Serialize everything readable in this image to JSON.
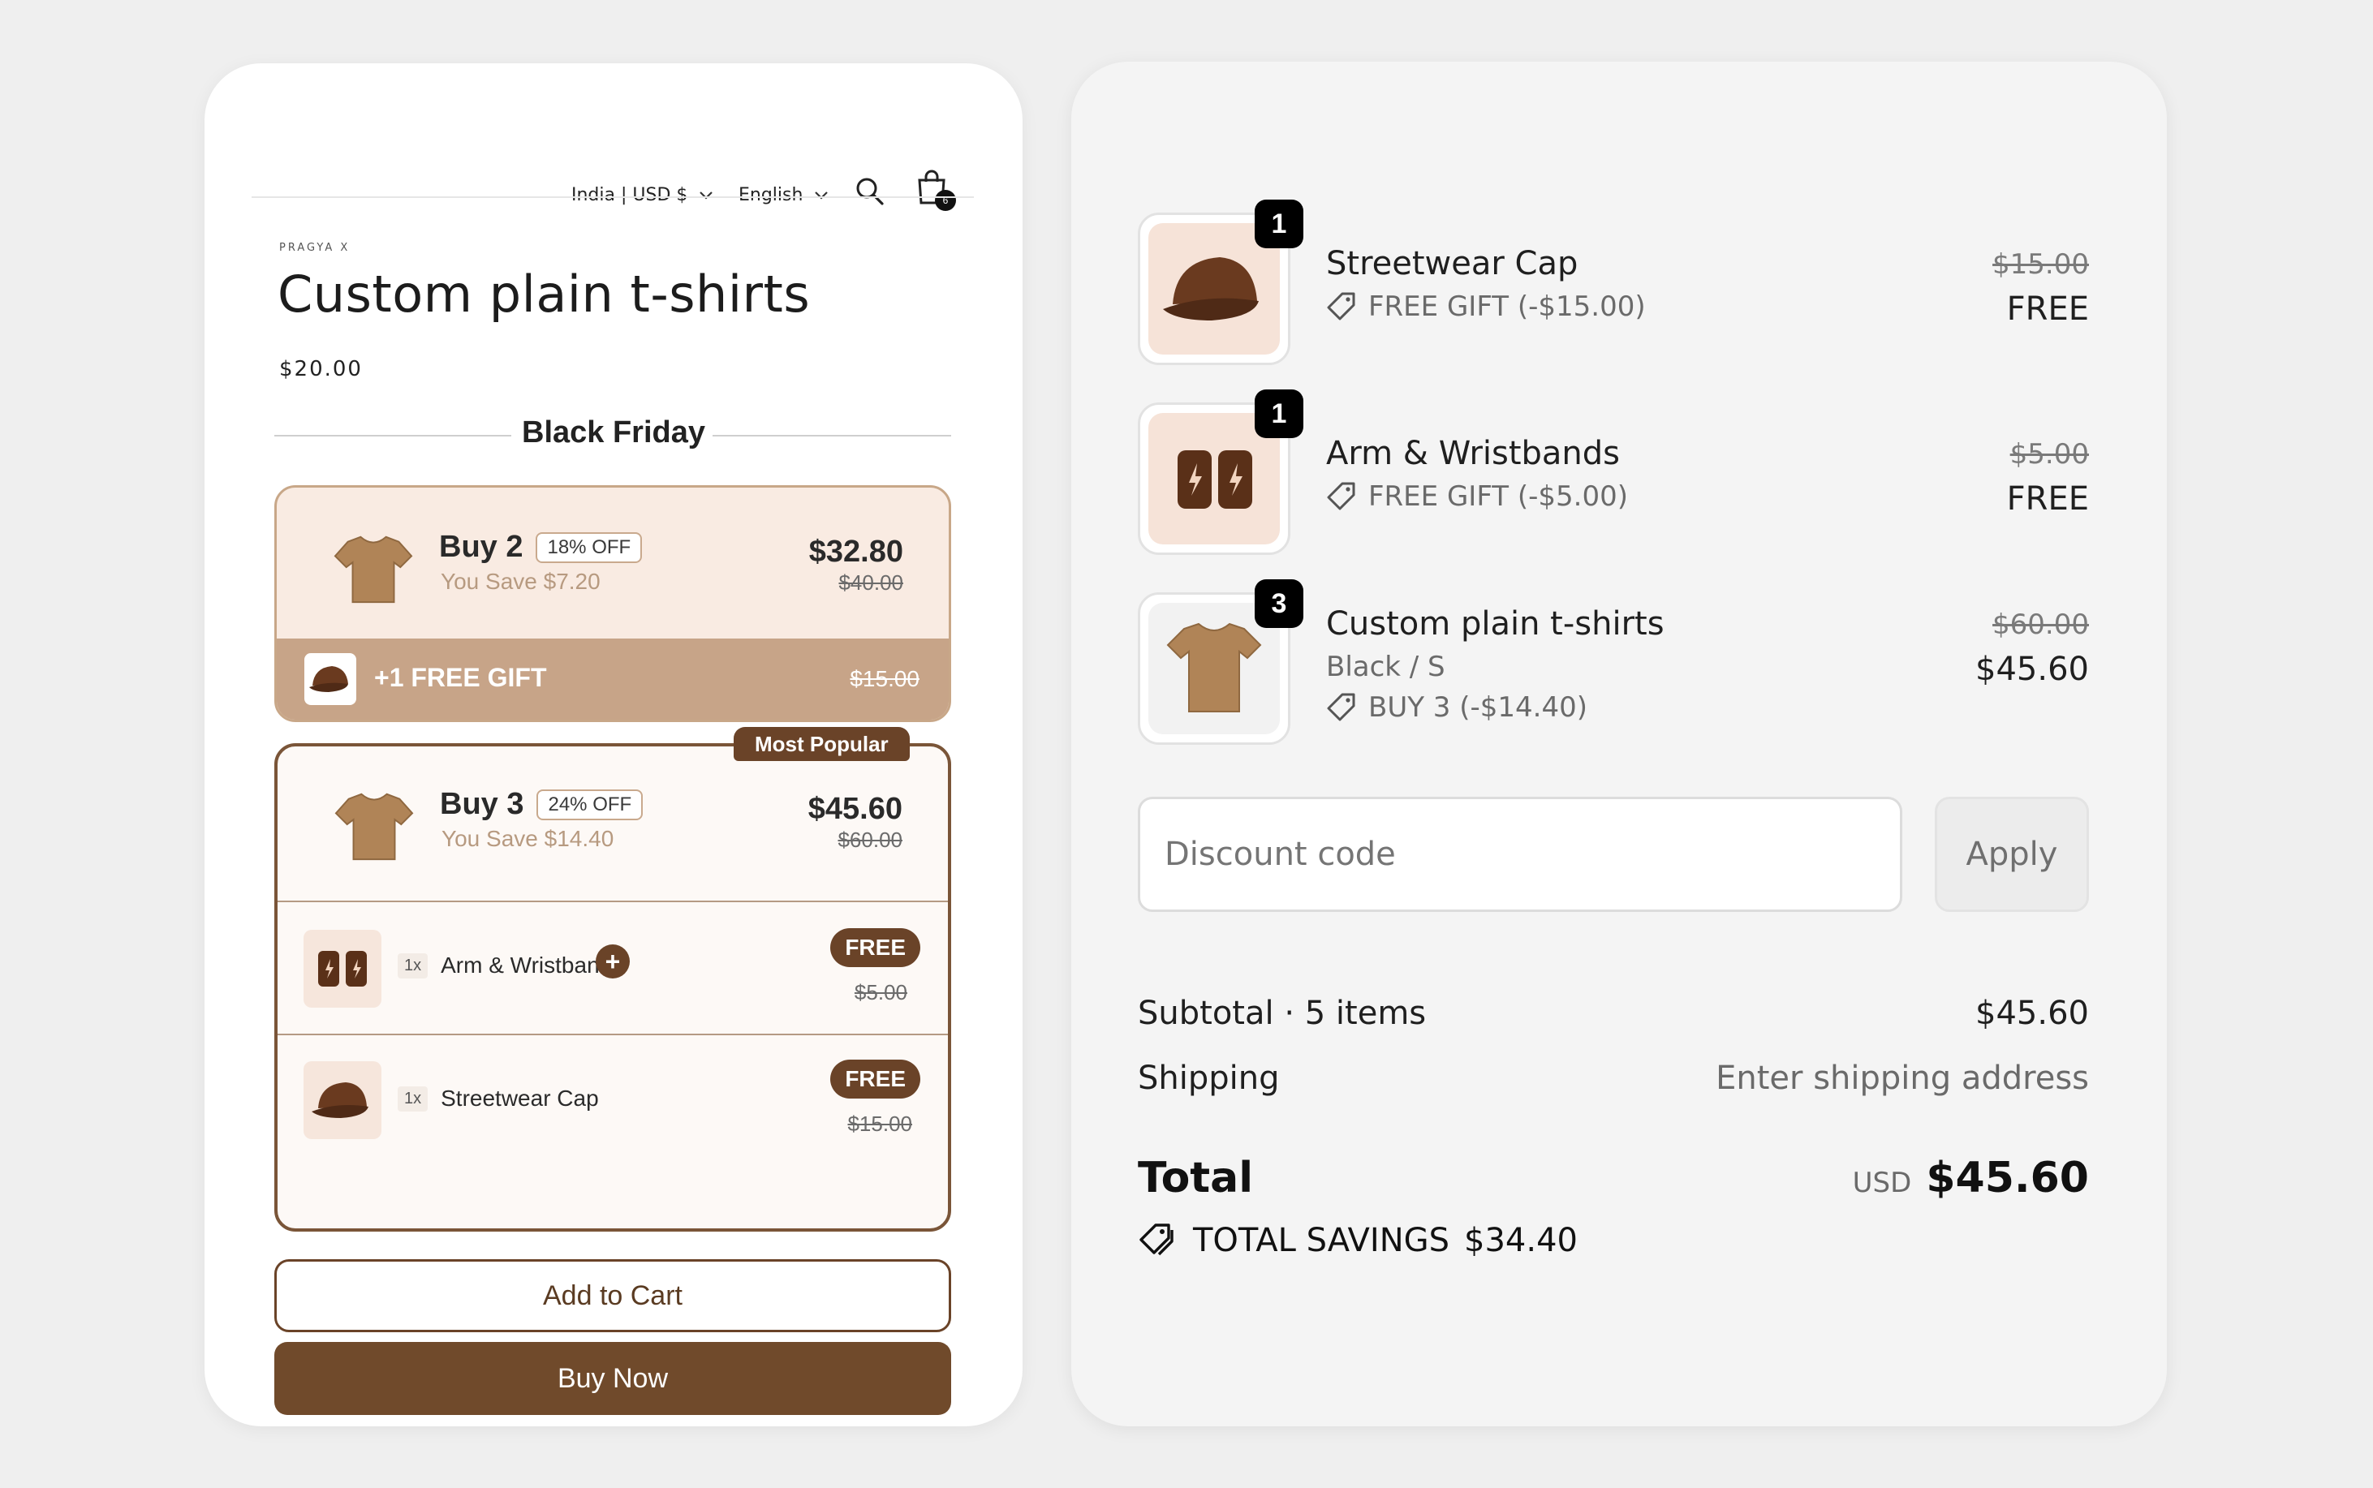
{
  "header": {
    "region": "India | USD $",
    "language": "English",
    "cart_count": "6"
  },
  "product": {
    "brand": "PRAGYA X",
    "title": "Custom plain t-shirts",
    "price": "$20.00"
  },
  "bundle_section": {
    "title": "Black Friday"
  },
  "offer1": {
    "label": "Buy 2",
    "badge": "18% OFF",
    "save": "You Save $7.20",
    "price": "$32.80",
    "compare": "$40.00",
    "gift_label": "+1 FREE GIFT",
    "gift_compare": "$15.00"
  },
  "offer2": {
    "popular": "Most Popular",
    "label": "Buy 3",
    "badge": "24% OFF",
    "save": "You Save $14.40",
    "price": "$45.60",
    "compare": "$60.00",
    "gifts": [
      {
        "qty": "1x",
        "name": "Arm & Wristbands",
        "free": "FREE",
        "compare": "$5.00"
      },
      {
        "qty": "1x",
        "name": "Streetwear Cap",
        "free": "FREE",
        "compare": "$15.00"
      }
    ]
  },
  "buttons": {
    "add_to_cart": "Add to Cart",
    "buy_now": "Buy Now"
  },
  "checkout": {
    "items": [
      {
        "qty": "1",
        "title": "Streetwear Cap",
        "variant": "",
        "discount": "FREE GIFT (-$15.00)",
        "compare": "$15.00",
        "price": "FREE"
      },
      {
        "qty": "1",
        "title": "Arm & Wristbands",
        "variant": "",
        "discount": "FREE GIFT (-$5.00)",
        "compare": "$5.00",
        "price": "FREE"
      },
      {
        "qty": "3",
        "title": "Custom plain t-shirts",
        "variant": "Black / S",
        "discount": "BUY 3 (-$14.40)",
        "compare": "$60.00",
        "price": "$45.60"
      }
    ],
    "discount_placeholder": "Discount code",
    "apply": "Apply",
    "subtotal_label": "Subtotal · 5 items",
    "subtotal_value": "$45.60",
    "shipping_label": "Shipping",
    "shipping_value": "Enter shipping address",
    "total_label": "Total",
    "currency": "USD",
    "total_value": "$45.60",
    "savings_label": "TOTAL SAVINGS",
    "savings_value": "$34.40"
  },
  "colors": {
    "brown": "#6a4328",
    "accent_light": "#f9ebe2",
    "gift_bar": "#c7a488"
  }
}
